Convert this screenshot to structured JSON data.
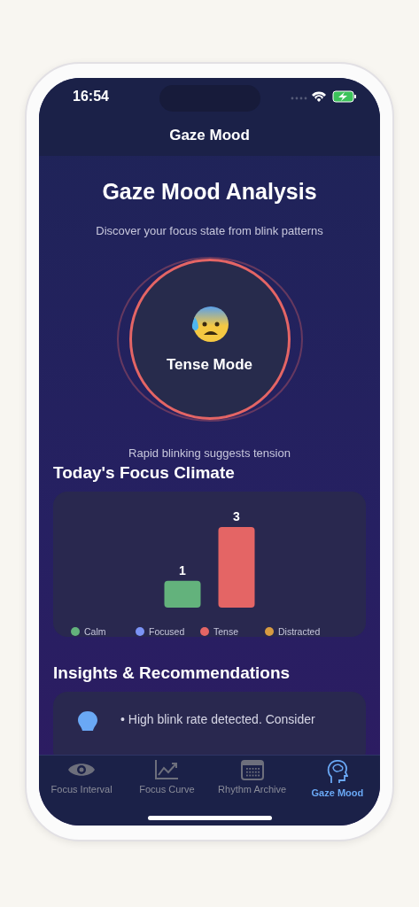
{
  "status_bar": {
    "time": "16:54"
  },
  "nav": {
    "title": "Gaze Mood"
  },
  "header": {
    "title": "Gaze Mood Analysis",
    "subtitle": "Discover your focus state from blink patterns"
  },
  "mood": {
    "label": "Tense Mode",
    "description": "Rapid blinking suggests tension"
  },
  "climate": {
    "title": "Today's Focus Climate",
    "chart_data": {
      "type": "bar",
      "data_labels": true,
      "series": [
        {
          "name": "Calm",
          "color": "#63b27c",
          "values": [
            1
          ]
        },
        {
          "name": "Focused",
          "color": "#7b93f5",
          "values": [
            null
          ]
        },
        {
          "name": "Tense",
          "color": "#e46565",
          "values": [
            3
          ]
        },
        {
          "name": "Distracted",
          "color": "#d79b41",
          "values": [
            null
          ]
        }
      ]
    }
  },
  "insights": {
    "title": "Insights & Recommendations",
    "items": [
      "• High blink rate detected. Consider"
    ]
  },
  "tabs": [
    {
      "label": "Focus Interval",
      "selected": false
    },
    {
      "label": "Focus Curve",
      "selected": false
    },
    {
      "label": "Rhythm Archive",
      "selected": false
    },
    {
      "label": "Gaze Mood",
      "selected": true
    }
  ]
}
